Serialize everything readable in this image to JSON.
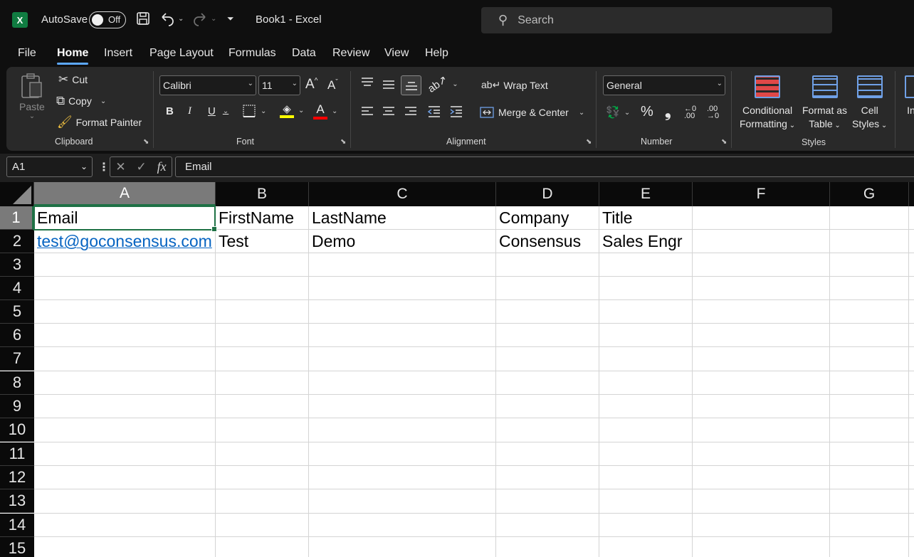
{
  "titlebar": {
    "app_icon_letter": "X",
    "autosave_label": "AutoSave",
    "autosave_state": "Off",
    "doc_title": "Book1  -  Excel",
    "search_placeholder": "Search"
  },
  "menu": {
    "tabs": [
      "File",
      "Home",
      "Insert",
      "Page Layout",
      "Formulas",
      "Data",
      "Review",
      "View",
      "Help"
    ],
    "active": "Home"
  },
  "ribbon": {
    "clipboard": {
      "paste": "Paste",
      "cut": "Cut",
      "copy": "Copy",
      "format_painter": "Format Painter",
      "label": "Clipboard"
    },
    "font": {
      "name": "Calibri",
      "size": "11",
      "bold": "B",
      "italic": "I",
      "underline": "U",
      "font_color_glyph": "A",
      "grow_glyph": "A^",
      "shrink_glyph": "Aˇ",
      "label": "Font"
    },
    "alignment": {
      "wrap_text": "Wrap Text",
      "merge_center": "Merge & Center",
      "label": "Alignment"
    },
    "number": {
      "format": "General",
      "percent": "%",
      "comma": "̩,",
      "label": "Number"
    },
    "styles": {
      "conditional_1": "Conditional",
      "conditional_2": "Formatting",
      "format_table_1": "Format as",
      "format_table_2": "Table",
      "cell_styles_1": "Cell",
      "cell_styles_2": "Styles",
      "label": "Styles",
      "cut_off": "In"
    }
  },
  "formula_bar": {
    "name_box": "A1",
    "fx": "fx",
    "content": "Email"
  },
  "grid": {
    "columns": [
      "A",
      "B",
      "C",
      "D",
      "E",
      "F",
      "G"
    ],
    "rows": [
      "1",
      "2",
      "3",
      "4",
      "5",
      "6",
      "7",
      "8",
      "9",
      "10",
      "11",
      "12",
      "13",
      "14",
      "15"
    ],
    "row1": [
      "Email",
      "FirstName",
      "LastName",
      "Company",
      "Title"
    ],
    "row2": [
      "test@goconsensus.com",
      "Test",
      "Demo",
      "Consensus",
      "Sales Engr"
    ]
  },
  "colors": {
    "accent": "#1e7145",
    "link": "#0563c1",
    "tab_underline": "#5ca8ff"
  }
}
